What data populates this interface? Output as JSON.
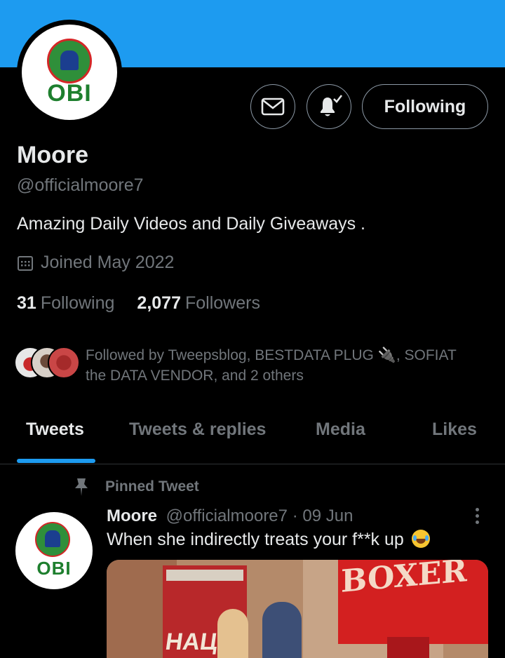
{
  "header": {
    "banner_color": "#1d9bf0",
    "avatar_logo_text": "OBI"
  },
  "actions": {
    "message_icon": "envelope-icon",
    "notify_icon": "bell-check-icon",
    "follow_label": "Following"
  },
  "profile": {
    "name": "Moore",
    "handle": "@officialmoore7",
    "bio": "Amazing Daily Videos and Daily Giveaways .",
    "joined": "Joined May 2022",
    "following_count": "31",
    "following_label": "Following",
    "followers_count": "2,077",
    "followers_label": "Followers",
    "followed_by": "Followed by Tweepsblog, BESTDATA PLUG 🔌, SOFIAT the DATA VENDOR, and 2 others"
  },
  "tabs": [
    {
      "label": "Tweets",
      "active": true
    },
    {
      "label": "Tweets & replies",
      "active": false
    },
    {
      "label": "Media",
      "active": false
    },
    {
      "label": "Likes",
      "active": false
    }
  ],
  "tweet": {
    "pinned_label": "Pinned Tweet",
    "author_name": "Moore",
    "author_handle": "@officialmoore7",
    "separator": "·",
    "date": "09 Jun",
    "text": "When she indirectly treats your f**k up",
    "emoji": "face-with-tears-of-joy",
    "avatar_logo_text": "OBI",
    "media_texts": {
      "poster": "НАЦ",
      "sign": "BOXER"
    }
  },
  "colors": {
    "accent": "#1d9bf0",
    "background": "#000000",
    "primary_text": "#e7e9ea",
    "secondary_text": "#71767b"
  }
}
